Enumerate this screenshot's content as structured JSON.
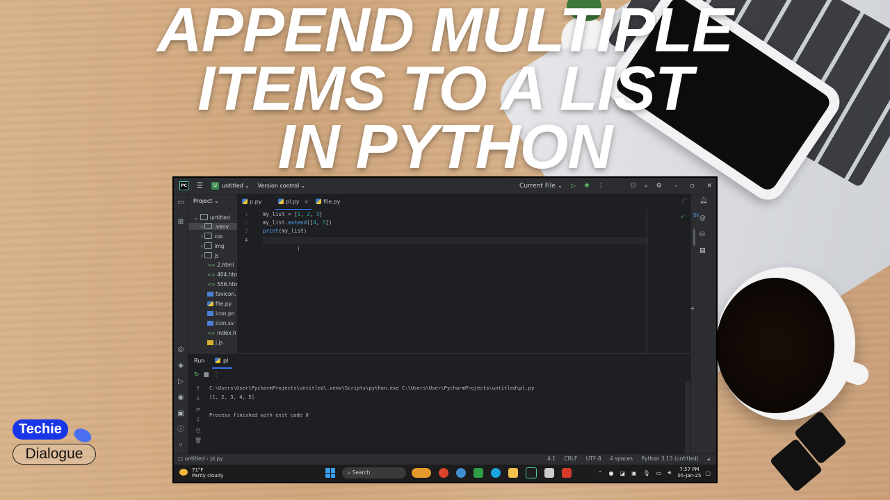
{
  "headline": {
    "line1": "APPEND MULTIPLE",
    "line2": "ITEMS TO A LIST",
    "line3": "IN PYTHON"
  },
  "logo": {
    "top": "Techie",
    "bottom": "Dialogue"
  },
  "ide": {
    "titlebar": {
      "app_icon": "PC",
      "project_badge": "U",
      "project_name": "untitled",
      "vcs": "Version control",
      "run_config": "Current File",
      "icons": [
        "hamburger-icon",
        "run-icon",
        "debug-icon",
        "more-icon",
        "user-icon",
        "search-icon",
        "gear-icon",
        "minimize-icon",
        "restore-icon",
        "close-icon"
      ]
    },
    "project_panel": {
      "title": "Project",
      "items": [
        {
          "label": "untitled",
          "kind": "folder"
        },
        {
          "label": ".venv",
          "kind": "folder"
        },
        {
          "label": "css",
          "kind": "folder"
        },
        {
          "label": "img",
          "kind": "folder"
        },
        {
          "label": "js",
          "kind": "folder"
        },
        {
          "label": "2.html",
          "kind": "html"
        },
        {
          "label": "404.htm",
          "kind": "html"
        },
        {
          "label": "556.htm",
          "kind": "html"
        },
        {
          "label": "favicon.",
          "kind": "image"
        },
        {
          "label": "file.py",
          "kind": "python"
        },
        {
          "label": "icon.pn",
          "kind": "image"
        },
        {
          "label": "icon.sv",
          "kind": "image"
        },
        {
          "label": "index.h",
          "kind": "html"
        },
        {
          "label": "j.js",
          "kind": "js"
        }
      ]
    },
    "tabs": [
      {
        "label": "p.py",
        "active": false
      },
      {
        "label": "pl.py",
        "active": true,
        "close": "×"
      },
      {
        "label": "file.py",
        "active": false
      }
    ],
    "editor": {
      "line_numbers": [
        "1",
        "2",
        "3",
        "4"
      ],
      "lines": [
        "my_list = [1, 2, 3]",
        "my_list.extend([4, 5])",
        "print(my_list)",
        ""
      ],
      "status_check": "✓"
    },
    "right_bar": {
      "label": "Sk"
    },
    "run_panel": {
      "title": "Run",
      "tab": "pl",
      "output": [
        "C:\\Users\\User\\PycharmProjects\\untitled\\.venv\\Scripts\\python.exe C:\\Users\\User\\PycharmProjects\\untitled\\pl.py",
        "[1, 2, 3, 4, 5]",
        "",
        "Process finished with exit code 0"
      ]
    },
    "status_bar": {
      "project": "untitled",
      "file": "pl.py",
      "position": "4:1",
      "line_sep": "CRLF",
      "encoding": "UTF-8",
      "indent": "4 spaces",
      "interpreter": "Python 3.13 (untitled)"
    },
    "taskbar": {
      "temp": "71°F",
      "weather": "Partly cloudy",
      "search_placeholder": "Search",
      "time": "7:57 PM",
      "date": "05-Jan-25"
    }
  }
}
